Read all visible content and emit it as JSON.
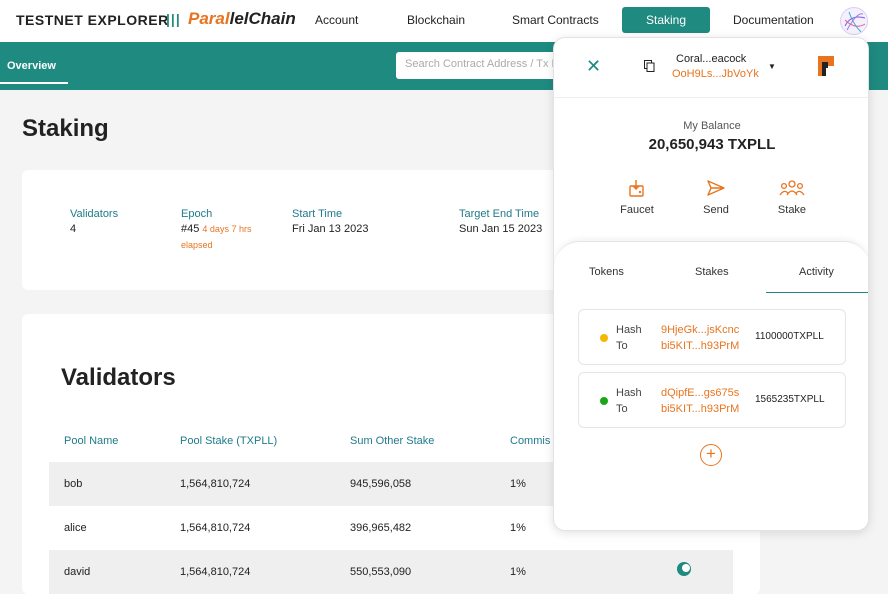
{
  "nav": {
    "brand": "TESTNET EXPLORER",
    "separator": "|||",
    "logo_part1": "Paral",
    "logo_part2": "lelChain",
    "items": [
      "Account",
      "Blockchain",
      "Smart Contracts",
      "Staking",
      "Documentation"
    ],
    "active_item": "Staking"
  },
  "subnav": {
    "overview": "Overview",
    "search_placeholder": "Search Contract Address / Tx Hash"
  },
  "page": {
    "title": "Staking",
    "stats": {
      "validators_label": "Validators",
      "validators_value": "4",
      "epoch_label": "Epoch",
      "epoch_value": "#45",
      "epoch_elapsed_1": "4 days 7 hrs",
      "epoch_elapsed_2": "elapsed",
      "start_label": "Start Time",
      "start_value": "Fri Jan 13 2023",
      "end_label": "Target End Time",
      "end_value": "Sun Jan 15 2023"
    },
    "validators": {
      "title": "Validators",
      "headers": [
        "Pool Name",
        "Pool Stake (TXPLL)",
        "Sum Other Stake",
        "Commis"
      ],
      "rows": [
        {
          "name": "bob",
          "pool_stake": "1,564,810,724",
          "other_stake": "945,596,058",
          "commission": "1%"
        },
        {
          "name": "alice",
          "pool_stake": "1,564,810,724",
          "other_stake": "396,965,482",
          "commission": "1%"
        },
        {
          "name": "david",
          "pool_stake": "1,564,810,724",
          "other_stake": "550,553,090",
          "commission": "1%"
        }
      ]
    }
  },
  "wallet": {
    "account_name": "Coral...eacock",
    "account_address": "OoH9Ls...JbVoYk",
    "balance_label": "My Balance",
    "balance_value": "20,650,943 TXPLL",
    "actions": [
      "Faucet",
      "Send",
      "Stake"
    ],
    "tabs": [
      "Tokens",
      "Stakes",
      "Activity"
    ],
    "active_tab": "Activity",
    "activity": [
      {
        "hash_label": "Hash",
        "to_label": "To",
        "hash": "9HjeGk...jsKcnc",
        "to": "bi5KIT...h93PrM",
        "amount": "1100000TXPLL",
        "status_color": "#f5b800"
      },
      {
        "hash_label": "Hash",
        "to_label": "To",
        "hash": "dQipfE...gs675s",
        "to": "bi5KIT...h93PrM",
        "amount": "1565235TXPLL",
        "status_color": "#1aa51a"
      }
    ]
  },
  "colors": {
    "teal": "#1f8a80",
    "orange": "#e8741f"
  }
}
